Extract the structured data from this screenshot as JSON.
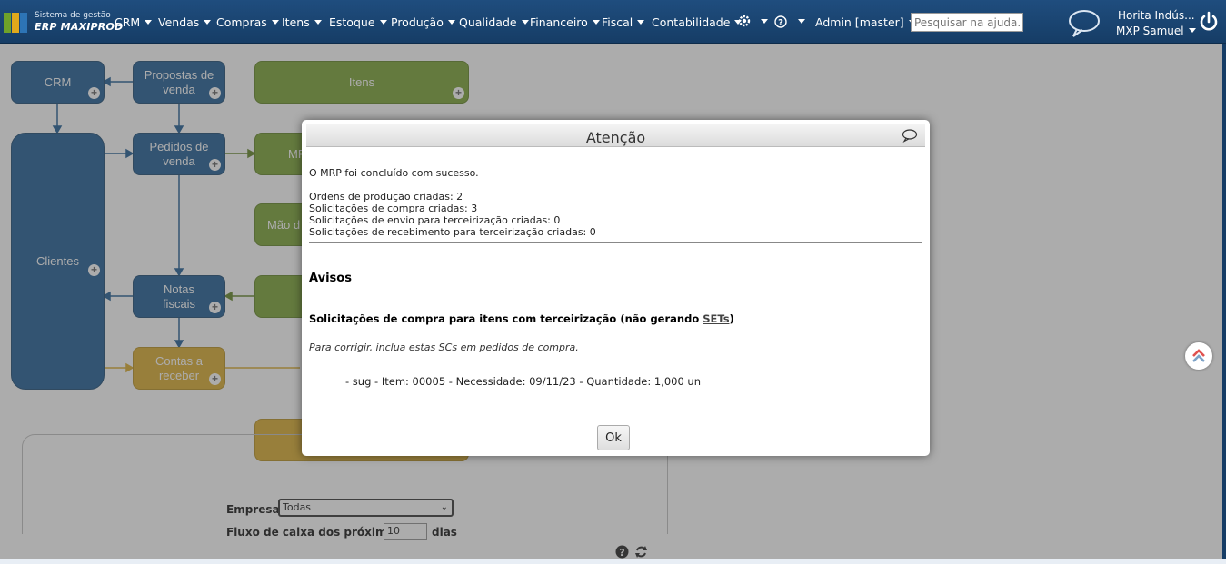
{
  "header": {
    "brand_top": "Sistema de gestão",
    "brand_main": "ERP MAXIPROD",
    "menu": [
      "CRM",
      "Vendas",
      "Compras",
      "Itens",
      "Estoque",
      "Produção",
      "Qualidade",
      "Financeiro",
      "Fiscal",
      "Contabilidade"
    ],
    "admin_label": "Admin [master]",
    "search_placeholder": "Pesquisar na ajuda...",
    "company": "Horita Indús...",
    "user": "MXP Samuel",
    "icons": [
      "gear-icon",
      "help-icon",
      "chat-icon",
      "power-icon"
    ]
  },
  "diagram": {
    "crm": "CRM",
    "propostas": "Propostas de venda",
    "itens": "Itens",
    "clientes": "Clientes",
    "pedidos": "Pedidos de venda",
    "mrp": "MR",
    "mao": "Mão d",
    "notas": "Notas fiscais",
    "contas": "Contas a receber"
  },
  "cashflow": {
    "empresa_label": "Empresa",
    "empresa_value": "Todas",
    "fluxo_label": "Fluxo de caixa dos próximos",
    "days_value": "10",
    "days_unit": "dias"
  },
  "modal": {
    "title": "Atenção",
    "success": "O MRP foi concluído com sucesso.",
    "lines": [
      "Ordens de produção criadas: 2",
      "Solicitações de compra criadas: 3",
      "Solicitações de envio para terceirização criadas: 0",
      "Solicitações de recebimento para terceirização criadas: 0"
    ],
    "avisos": "Avisos",
    "warn_prefix": "Solicitações de compra para itens com terceirização (não gerando ",
    "warn_link": "SETs",
    "warn_suffix": ")",
    "fix": "Para corrigir, inclua estas SCs em pedidos de compra.",
    "item": "- sug - Item: 00005 - Necessidade: 09/11/23 - Quantidade: 1,000 un",
    "ok": "Ok"
  }
}
